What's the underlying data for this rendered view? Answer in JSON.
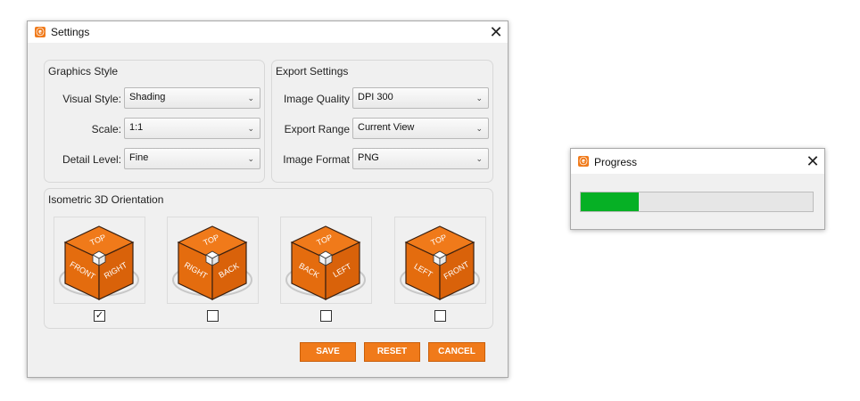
{
  "settings": {
    "title": "Settings",
    "graphics": {
      "title": "Graphics Style",
      "visual_style_label": "Visual Style:",
      "visual_style_value": "Shading",
      "scale_label": "Scale:",
      "scale_value": "1:1",
      "detail_label": "Detail Level:",
      "detail_value": "Fine"
    },
    "export": {
      "title": "Export Settings",
      "quality_label": "Image Quality",
      "quality_value": "DPI 300",
      "range_label": "Export Range",
      "range_value": "Current View",
      "format_label": "Image Format",
      "format_value": "PNG"
    },
    "iso": {
      "title": "Isometric 3D Orientation",
      "cubes": [
        {
          "top": "TOP",
          "left": "FRONT",
          "right": "RIGHT",
          "checked": true
        },
        {
          "top": "TOP",
          "left": "RIGHT",
          "right": "BACK",
          "checked": false
        },
        {
          "top": "TOP",
          "left": "BACK",
          "right": "LEFT",
          "checked": false
        },
        {
          "top": "TOP",
          "left": "LEFT",
          "right": "FRONT",
          "checked": false
        }
      ]
    },
    "buttons": {
      "save": "SAVE",
      "reset": "RESET",
      "cancel": "CANCEL"
    }
  },
  "progress": {
    "title": "Progress",
    "fraction": 0.25
  },
  "colors": {
    "accent": "#f07a1a",
    "progress": "#06b025"
  }
}
